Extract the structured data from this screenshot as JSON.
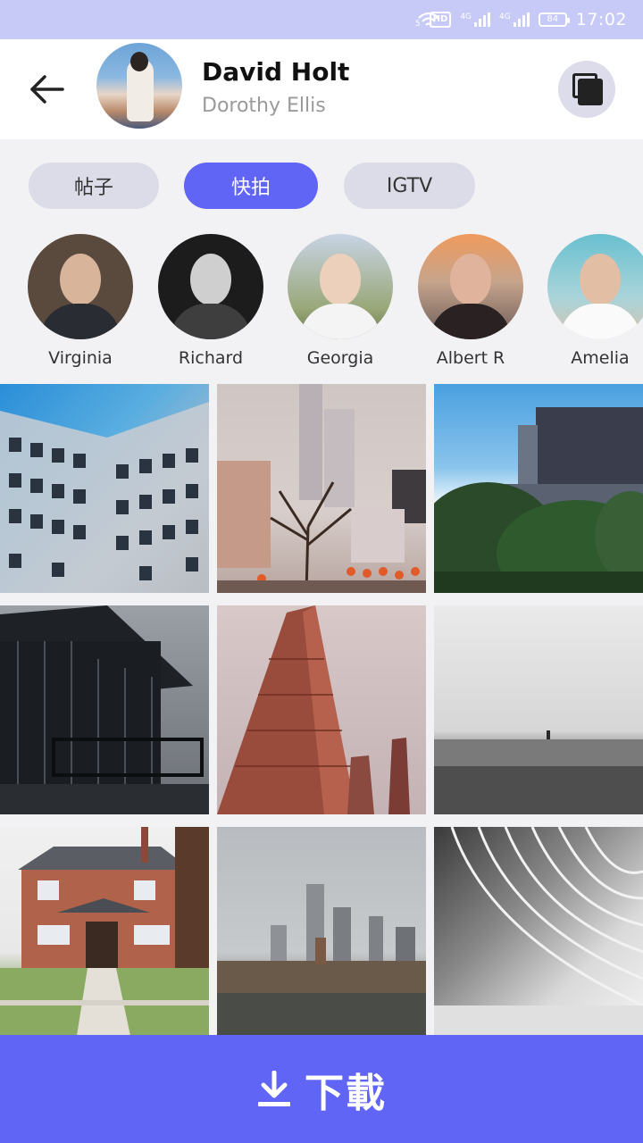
{
  "status_bar": {
    "wifi_icon": "wifi-icon",
    "wifi_label": "5",
    "hd_label": "HD",
    "network_label_1": "4G",
    "network_label_2": "4G",
    "battery_level": "84",
    "time": "17:02"
  },
  "header": {
    "back_icon": "arrow-left-icon",
    "name": "David Holt",
    "subname": "Dorothy Ellis",
    "copy_icon": "copy-icon"
  },
  "tabs": [
    {
      "label": "帖子",
      "active": false
    },
    {
      "label": "快拍",
      "active": true
    },
    {
      "label": "IGTV",
      "active": false
    }
  ],
  "stories": [
    {
      "name": "Virginia"
    },
    {
      "name": "Richard"
    },
    {
      "name": "Georgia"
    },
    {
      "name": "Albert R"
    },
    {
      "name": "Amelia"
    }
  ],
  "grid": {
    "photos": [
      {
        "subject": "modern-building-facade"
      },
      {
        "subject": "city-towers-with-tree"
      },
      {
        "subject": "building-behind-trees"
      },
      {
        "subject": "dark-glass-house"
      },
      {
        "subject": "copper-skyscraper"
      },
      {
        "subject": "bw-beach-horizon"
      },
      {
        "subject": "brick-house"
      },
      {
        "subject": "foggy-city-skyline"
      },
      {
        "subject": "bw-curved-architecture"
      }
    ]
  },
  "download": {
    "icon": "download-icon",
    "label": "下載"
  },
  "colors": {
    "accent": "#6165f5",
    "status_bar": "#c7c9f7",
    "tab_inactive": "#dcdce8"
  }
}
